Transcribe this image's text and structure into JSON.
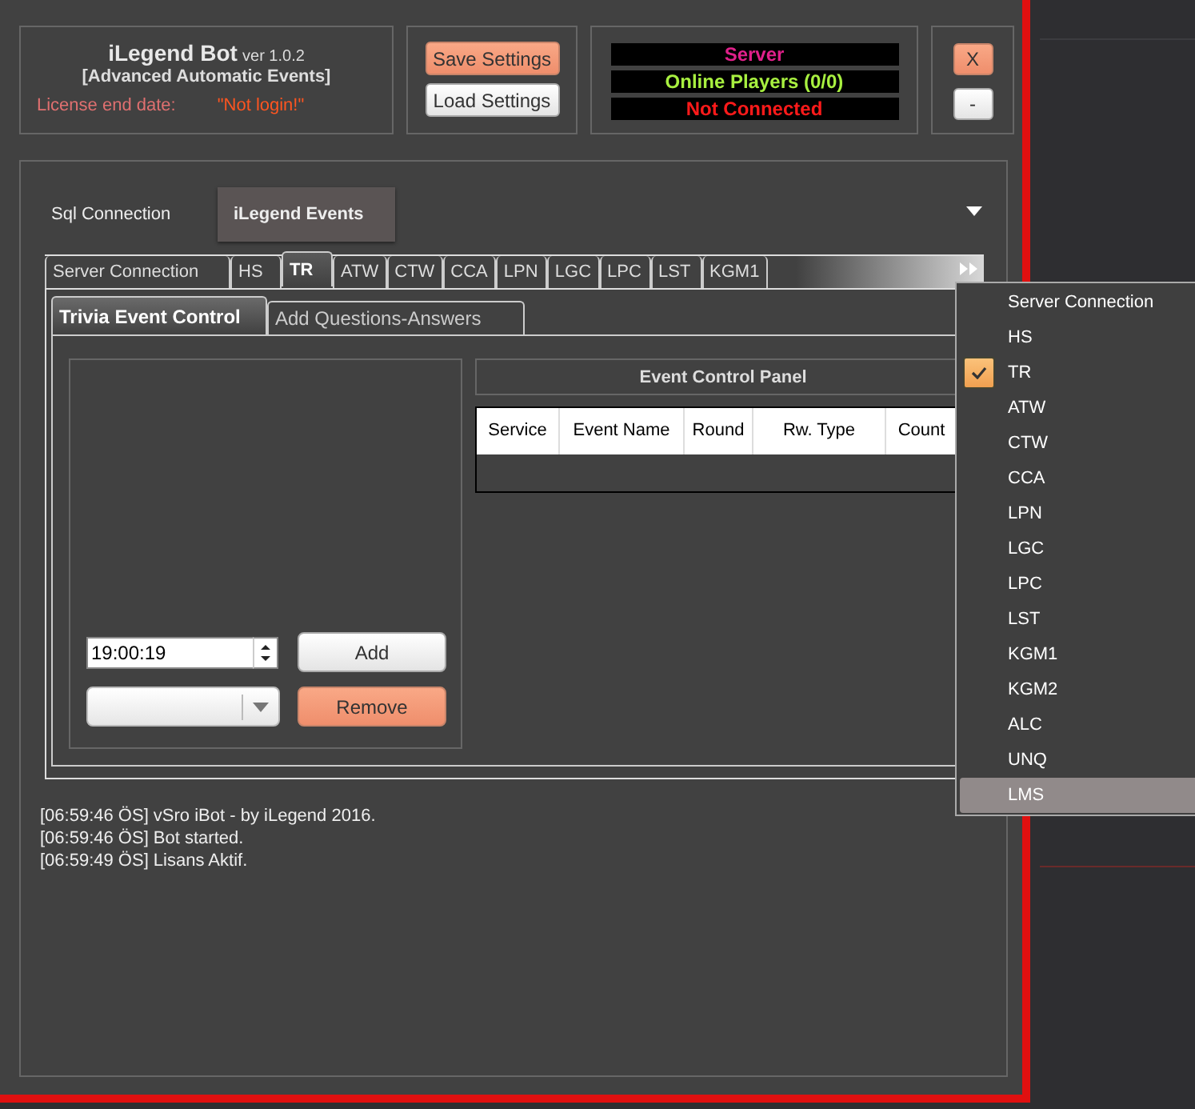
{
  "header": {
    "title": "iLegend Bot",
    "version": "ver 1.0.2",
    "subtitle": "[Advanced Automatic Events]",
    "license_label": "License end date:",
    "license_value": "\"Not login!\""
  },
  "settings_buttons": [
    {
      "label": "Save Settings",
      "kind": "accent"
    },
    {
      "label": "Load Settings",
      "kind": "plain"
    }
  ],
  "status": [
    {
      "text": "Server",
      "kind": "heading"
    },
    {
      "text": "Online Players (0/0)",
      "kind": "info"
    },
    {
      "text": "Not Connected",
      "kind": "error"
    }
  ],
  "window_buttons": [
    {
      "label": "X",
      "kind": "accent"
    },
    {
      "label": "-",
      "kind": "plain"
    }
  ],
  "main_tabs": [
    {
      "label": "Sql Connection",
      "selected": false
    },
    {
      "label": "iLegend Events",
      "selected": true
    }
  ],
  "event_tabs": [
    {
      "label": "Server Connection",
      "selected": false
    },
    {
      "label": "HS",
      "selected": false
    },
    {
      "label": "TR",
      "selected": true
    },
    {
      "label": "ATW",
      "selected": false
    },
    {
      "label": "CTW",
      "selected": false
    },
    {
      "label": "CCA",
      "selected": false
    },
    {
      "label": "LPN",
      "selected": false
    },
    {
      "label": "LGC",
      "selected": false
    },
    {
      "label": "LPC",
      "selected": false
    },
    {
      "label": "LST",
      "selected": false
    },
    {
      "label": "KGM1",
      "selected": false
    }
  ],
  "sub_tabs": [
    {
      "label": "Trivia Event Control",
      "selected": true
    },
    {
      "label": "Add Questions-Answers",
      "selected": false
    }
  ],
  "time_field": {
    "value": "19:00:19"
  },
  "action_buttons": [
    {
      "label": "Add",
      "kind": "plain"
    },
    {
      "label": "Remove",
      "kind": "accent"
    }
  ],
  "panel_title": "Event Control Panel",
  "table": {
    "columns": [
      "Service",
      "Event Name",
      "Round",
      "Rw. Type",
      "Count"
    ]
  },
  "log": [
    "[06:59:46 ÖS] vSro iBot - by iLegend 2016.",
    "[06:59:46 ÖS] Bot started.",
    "[06:59:49 ÖS] Lisans Aktif."
  ],
  "tab_menu": {
    "items": [
      {
        "label": "Server Connection",
        "checked": false,
        "selected": false
      },
      {
        "label": "HS",
        "checked": false,
        "selected": false
      },
      {
        "label": "TR",
        "checked": true,
        "selected": false
      },
      {
        "label": "ATW",
        "checked": false,
        "selected": false
      },
      {
        "label": "CTW",
        "checked": false,
        "selected": false
      },
      {
        "label": "CCA",
        "checked": false,
        "selected": false
      },
      {
        "label": "LPN",
        "checked": false,
        "selected": false
      },
      {
        "label": "LGC",
        "checked": false,
        "selected": false
      },
      {
        "label": "LPC",
        "checked": false,
        "selected": false
      },
      {
        "label": "LST",
        "checked": false,
        "selected": false
      },
      {
        "label": "KGM1",
        "checked": false,
        "selected": false
      },
      {
        "label": "KGM2",
        "checked": false,
        "selected": false
      },
      {
        "label": "ALC",
        "checked": false,
        "selected": false
      },
      {
        "label": "UNQ",
        "checked": false,
        "selected": false
      },
      {
        "label": "LMS",
        "checked": false,
        "selected": true
      }
    ]
  }
}
